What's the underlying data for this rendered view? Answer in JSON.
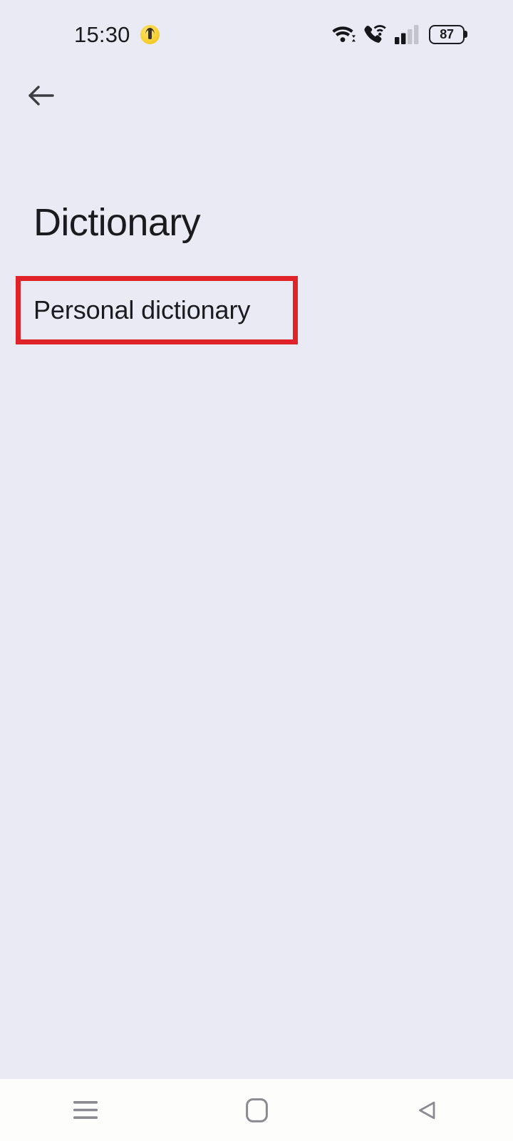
{
  "status_bar": {
    "clock": "15:30",
    "notification_badge": "emoji-notification-badge",
    "icons": {
      "wifi": "wifi-icon",
      "wifi_calling": "wifi-calling-icon",
      "signal": "cellular-signal-icon",
      "battery": "battery-icon"
    },
    "battery_level": "87"
  },
  "app_bar": {
    "back_label": "Back"
  },
  "page": {
    "title": "Dictionary"
  },
  "list": {
    "items": [
      {
        "label": "Personal dictionary",
        "highlighted": true
      }
    ]
  },
  "annotation": {
    "color": "#e02229",
    "target": "Personal dictionary"
  },
  "nav_bar": {
    "buttons": [
      {
        "name": "recents",
        "label": "Recent apps"
      },
      {
        "name": "home",
        "label": "Home"
      },
      {
        "name": "back",
        "label": "Back"
      }
    ]
  },
  "colors": {
    "background": "#eaeaf4",
    "text_primary": "#1b1b1f",
    "nav_background": "#fdfdfb",
    "nav_icon": "#8a8a90",
    "accent_highlight": "#e02229"
  }
}
